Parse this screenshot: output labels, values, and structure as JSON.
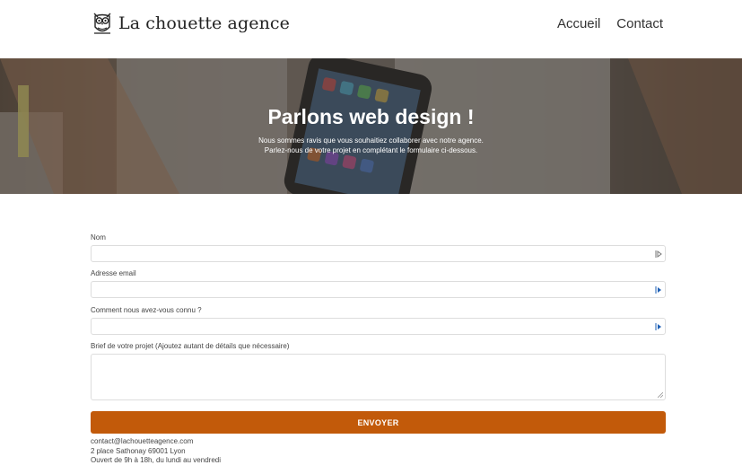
{
  "header": {
    "logo_text": "La chouette agence",
    "logo_icon": "owl-icon",
    "nav": [
      {
        "label": "Accueil"
      },
      {
        "label": "Contact"
      }
    ]
  },
  "hero": {
    "title": "Parlons web design !",
    "subtitle_line1": "Nous sommes ravis que vous souhaitiez collaborer avec notre agence.",
    "subtitle_line2": "Parlez-nous de votre projet en complétant le formulaire ci-dessous."
  },
  "form": {
    "fields": [
      {
        "label": "Nom",
        "value": ""
      },
      {
        "label": "Adresse email",
        "value": ""
      },
      {
        "label": "Comment nous avez-vous connu ?",
        "value": ""
      }
    ],
    "brief": {
      "label": "Brief de votre projet (Ajoutez autant de détails que nécessaire)",
      "value": ""
    },
    "submit_label": "ENVOYER",
    "field_icon": "autofill-icon"
  },
  "footer": {
    "email": "contact@lachouetteagence.com",
    "address": "2 place Sathonay 69001 Lyon",
    "hours": "Ouvert de 9h à 18h, du lundi au vendredi"
  },
  "colors": {
    "accent": "#c25a0a",
    "text": "#333333",
    "input_border": "#dddddd"
  }
}
